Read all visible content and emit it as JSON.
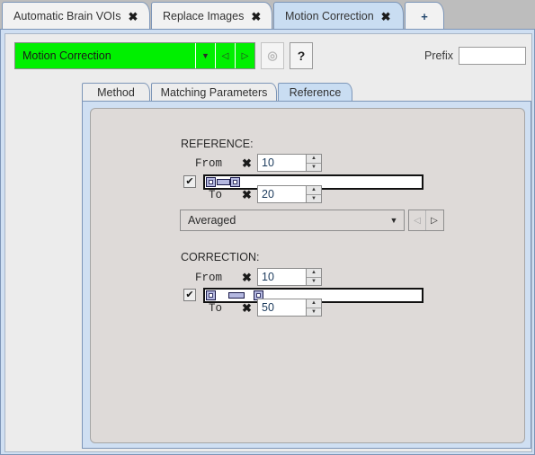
{
  "window": {
    "tabs": [
      {
        "label": "Automatic Brain VOIs",
        "close": "✖",
        "active": false
      },
      {
        "label": "Replace Images",
        "close": "✖",
        "active": false
      },
      {
        "label": "Motion Correction",
        "close": "✖",
        "active": true
      }
    ],
    "add_tab_label": "+"
  },
  "toolbar": {
    "title": "Motion Correction",
    "dropdown_icon": "▼",
    "prev_icon": "◁",
    "next_icon": "▷",
    "target_icon": "◎",
    "help_icon": "?",
    "prefix_label": "Prefix",
    "prefix_value": "",
    "prefix_placeholder": ""
  },
  "inner_tabs": [
    {
      "label": "Method",
      "active": false
    },
    {
      "label": "Matching Parameters",
      "active": false
    },
    {
      "label": "Reference",
      "active": true
    }
  ],
  "reference": {
    "heading": "REFERENCE:",
    "from_label": "From",
    "from_x": "✖",
    "from_value": "10",
    "to_label": "To",
    "to_x": "✖",
    "to_value": "20",
    "checkbox_checked": "✔",
    "range_min": 10,
    "range_max": 20,
    "mode_value": "Averaged",
    "mode_arrow": "▼",
    "nav_prev": "◁",
    "nav_next": "▷"
  },
  "correction": {
    "heading": "CORRECTION:",
    "from_label": "From",
    "from_x": "✖",
    "from_value": "10",
    "to_label": "To",
    "to_x": "✖",
    "to_value": "50",
    "checkbox_checked": "✔",
    "range_min": 10,
    "range_max": 50
  },
  "spinner": {
    "up_icon": "▲",
    "down_icon": "▼"
  },
  "colors": {
    "accent_green": "#00f000",
    "tab_active": "#c9ddf2",
    "panel_bg": "#dedad8",
    "window_bg": "#ececec",
    "frame_blue": "#7d96b8",
    "handle_fill": "#b4b8e0"
  }
}
